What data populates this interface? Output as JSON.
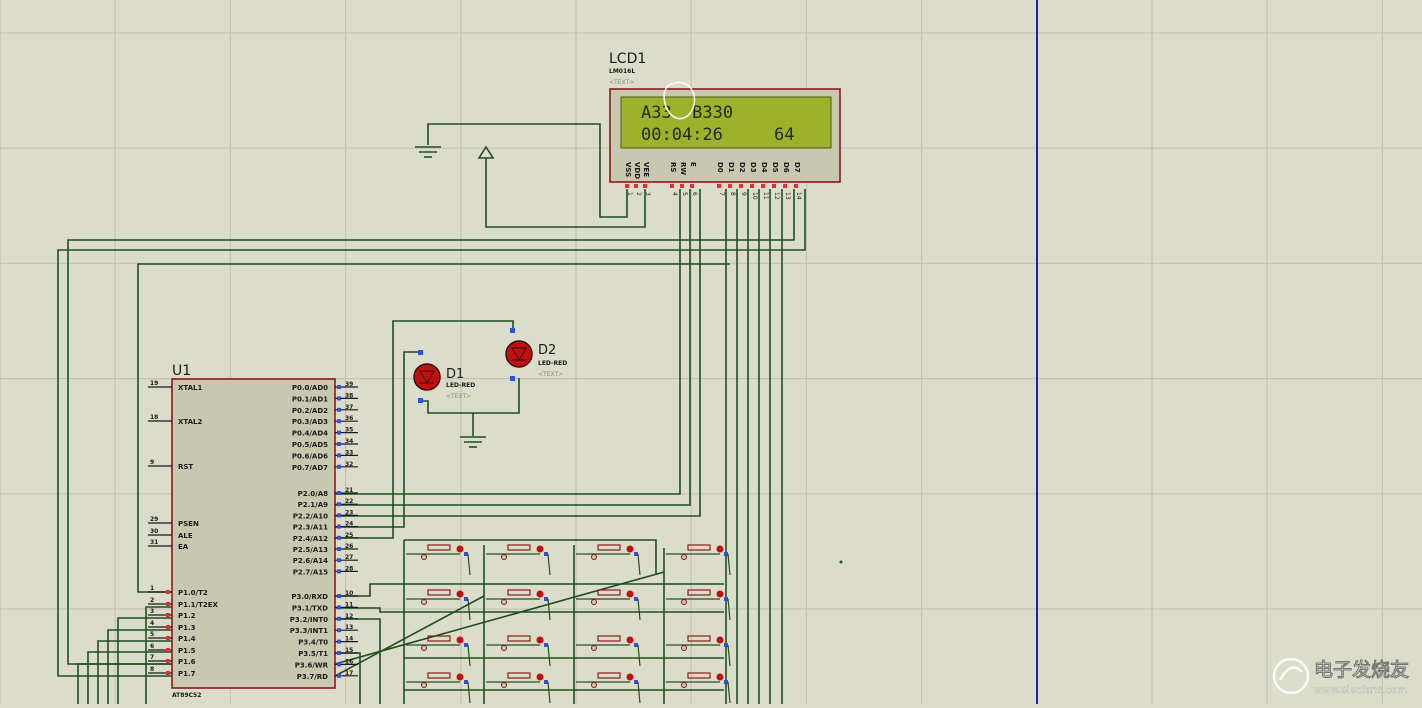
{
  "lcd": {
    "ref": "LCD1",
    "model": "LM016L",
    "text_placeholder": "<TEXT>",
    "line1": "A33  B330",
    "line2": "00:04:26     64",
    "pin_labels": [
      "VSS",
      "VDD",
      "VEE",
      "RS",
      "RW",
      "E",
      "D0",
      "D1",
      "D2",
      "D3",
      "D4",
      "D5",
      "D6",
      "D7"
    ],
    "pin_numbers": [
      "1",
      "2",
      "3",
      "4",
      "5",
      "6",
      "7",
      "8",
      "9",
      "10",
      "11",
      "12",
      "13",
      "14"
    ]
  },
  "mcu": {
    "ref": "U1",
    "model": "AT89C52",
    "left_pins": [
      {
        "num": "19",
        "label": "XTAL1"
      },
      {
        "num": "18",
        "label": "XTAL2"
      },
      {
        "num": "9",
        "label": "RST"
      },
      {
        "num": "29",
        "label": "PSEN"
      },
      {
        "num": "30",
        "label": "ALE"
      },
      {
        "num": "31",
        "label": "EA"
      },
      {
        "num": "1",
        "label": "P1.0/T2"
      },
      {
        "num": "2",
        "label": "P1.1/T2EX"
      },
      {
        "num": "3",
        "label": "P1.2"
      },
      {
        "num": "4",
        "label": "P1.3"
      },
      {
        "num": "5",
        "label": "P1.4"
      },
      {
        "num": "6",
        "label": "P1.5"
      },
      {
        "num": "7",
        "label": "P1.6"
      },
      {
        "num": "8",
        "label": "P1.7"
      }
    ],
    "right_pins": [
      {
        "num": "39",
        "label": "P0.0/AD0"
      },
      {
        "num": "38",
        "label": "P0.1/AD1"
      },
      {
        "num": "37",
        "label": "P0.2/AD2"
      },
      {
        "num": "36",
        "label": "P0.3/AD3"
      },
      {
        "num": "35",
        "label": "P0.4/AD4"
      },
      {
        "num": "34",
        "label": "P0.5/AD5"
      },
      {
        "num": "33",
        "label": "P0.6/AD6"
      },
      {
        "num": "32",
        "label": "P0.7/AD7"
      },
      {
        "num": "21",
        "label": "P2.0/A8"
      },
      {
        "num": "22",
        "label": "P2.1/A9"
      },
      {
        "num": "23",
        "label": "P2.2/A10"
      },
      {
        "num": "24",
        "label": "P2.3/A11"
      },
      {
        "num": "25",
        "label": "P2.4/A12"
      },
      {
        "num": "26",
        "label": "P2.5/A13"
      },
      {
        "num": "27",
        "label": "P2.6/A14"
      },
      {
        "num": "28",
        "label": "P2.7/A15"
      },
      {
        "num": "10",
        "label": "P3.0/RXD"
      },
      {
        "num": "11",
        "label": "P3.1/TXD"
      },
      {
        "num": "12",
        "label": "P3.2/INT0"
      },
      {
        "num": "13",
        "label": "P3.3/INT1"
      },
      {
        "num": "14",
        "label": "P3.4/T0"
      },
      {
        "num": "15",
        "label": "P3.5/T1"
      },
      {
        "num": "16",
        "label": "P3.6/WR"
      },
      {
        "num": "17",
        "label": "P3.7/RD"
      }
    ]
  },
  "leds": [
    {
      "ref": "D1",
      "model": "LED-RED",
      "text_placeholder": "<TEXT>"
    },
    {
      "ref": "D2",
      "model": "LED-RED",
      "text_placeholder": "<TEXT>"
    }
  ],
  "watermark": {
    "name": "电子发烧友",
    "url": "www.elecfans.com"
  },
  "colors": {
    "background": "#dcdcca",
    "grid": "#c4c4b2",
    "wire": "#1f4f1f",
    "component_outline": "#8b1a1a",
    "component_body": "#c8c8b0",
    "lcd_screen": "#9db22a",
    "lcd_text": "#1e2a08",
    "led_red": "#c01010",
    "pin_red": "#e03030",
    "pin_blue": "#3050e0",
    "marker_line": "#2222bb"
  }
}
